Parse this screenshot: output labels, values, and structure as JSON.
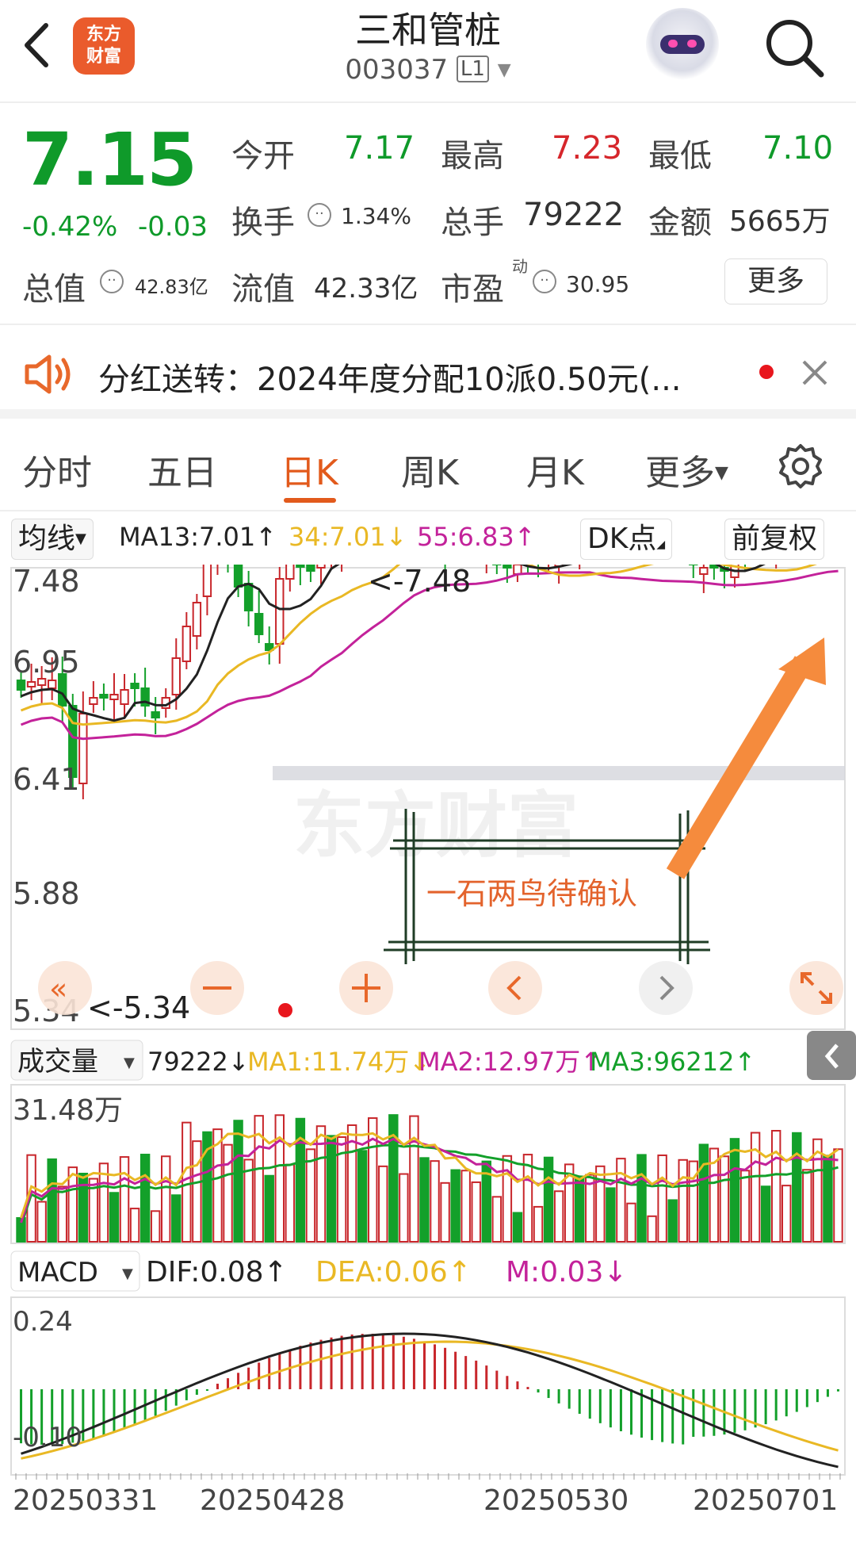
{
  "header": {
    "logo_text": "东方财富",
    "stock_name": "三和管桩",
    "stock_code": "003037",
    "level": "L1"
  },
  "quote": {
    "price": "7.15",
    "change_pct": "-0.42%",
    "change": "-0.03",
    "open_label": "今开",
    "open": "7.17",
    "high_label": "最高",
    "high": "7.23",
    "low_label": "最低",
    "low": "7.10",
    "turnover_label": "换手",
    "turnover": "1.34%",
    "volume_label": "总手",
    "volume": "79222",
    "amount_label": "金额",
    "amount": "5665万",
    "mcap_label": "总值",
    "mcap": "42.83亿",
    "float_label": "流值",
    "float": "42.33亿",
    "pe_label": "市盈",
    "pe_sup": "动",
    "pe": "30.95",
    "more": "更多"
  },
  "notice": {
    "text": "分红送转：2024年度分配10派0.50元(..."
  },
  "tabs": [
    {
      "label": "分时"
    },
    {
      "label": "五日"
    },
    {
      "label": "日K"
    },
    {
      "label": "周K"
    },
    {
      "label": "月K"
    },
    {
      "label": "更多"
    }
  ],
  "kline_toolbar": {
    "indicator": "均线",
    "ma13": "MA13:7.01↑",
    "ma34": "34:7.01↓",
    "ma55": "55:6.83↑",
    "dk": "DK点",
    "adjust": "前复权"
  },
  "colors": {
    "up": "#c8262b",
    "down": "#13a02a",
    "ma13": "#222222",
    "ma34": "#e9b824",
    "ma55": "#c3229a",
    "accent": "#e25a1c"
  },
  "kline": {
    "y_labels": [
      "7.48",
      "6.95",
      "6.41",
      "5.88",
      "5.34"
    ],
    "high_mark": "<-7.48",
    "low_mark": "<-5.34",
    "annotation": "一石两鸟待确认",
    "watermark": "东方财富"
  },
  "volume_toolbar": {
    "indicator": "成交量",
    "vol": "79222↓",
    "ma1": "MA1:11.74万↓",
    "ma2": "MA2:12.97万↑",
    "ma3": "MA3:96212↑"
  },
  "volume": {
    "y_label": "31.48万"
  },
  "macd_toolbar": {
    "indicator": "MACD",
    "dif": "DIF:0.08↑",
    "dea": "DEA:0.06↑",
    "m": "M:0.03↓"
  },
  "macd": {
    "y_top": "0.24",
    "y_bottom": "-0.10"
  },
  "dates": [
    "20250331",
    "20250428",
    "20250530",
    "20250701"
  ]
}
